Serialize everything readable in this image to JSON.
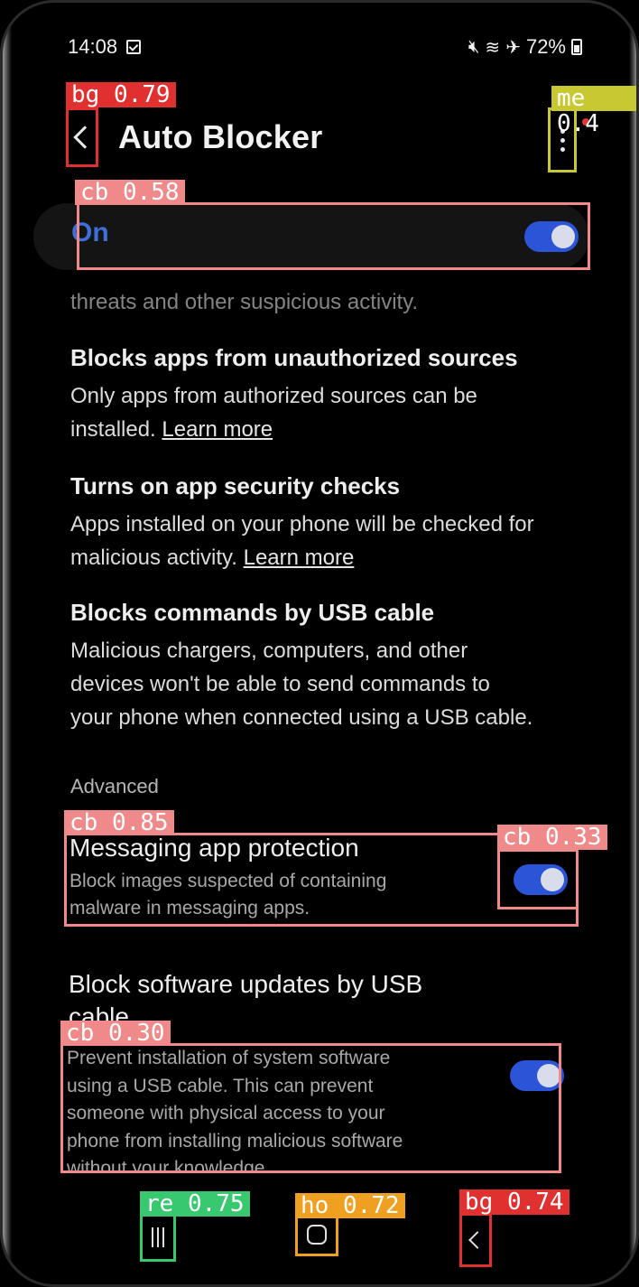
{
  "status_bar": {
    "time": "14:08",
    "battery": "72%"
  },
  "app_bar": {
    "title": "Auto Blocker"
  },
  "master_toggle": {
    "label": "On",
    "checked": true
  },
  "partial_text": "threats and other suspicious activity.",
  "features": [
    {
      "heading": "Blocks apps from unauthorized sources",
      "body_line1": "Only apps from authorized sources can be",
      "body_line2": "installed.",
      "link": "Learn more"
    },
    {
      "heading": "Turns on app security checks",
      "body_line1": "Apps installed on your phone will be checked for",
      "body_line2": "malicious activity.",
      "link": "Learn more"
    },
    {
      "heading": "Blocks commands by USB cable",
      "body_line1": "Malicious chargers, computers, and other",
      "body_line2": "devices won't be able to send commands to",
      "body_line3": "your phone when connected using a USB cable."
    }
  ],
  "advanced": {
    "section_label": "Advanced",
    "messaging": {
      "title": "Messaging app protection",
      "subtitle_line1": "Block images suspected of containing",
      "subtitle_line2": "malware in messaging apps.",
      "checked": true
    },
    "usb_updates": {
      "title_line1": "Block software updates by USB",
      "title_line2": "cable",
      "subtitle_line1": "Prevent installation of system software",
      "subtitle_line2": "using a USB cable. This can prevent",
      "subtitle_line3": "someone with physical access to your",
      "subtitle_line4": "phone from installing malicious software",
      "subtitle_line5": "without your knowledge.",
      "checked": true
    }
  },
  "detections": {
    "back_top": "bg 0.79",
    "menu": "me 0.4",
    "master_cb": "cb 0.58",
    "messaging_cb": "cb 0.85",
    "messaging_switch_cb": "cb 0.33",
    "usb_cb": "cb 0.30",
    "recents": "re 0.75",
    "home": "ho 0.72",
    "back_bottom": "bg 0.74"
  },
  "colors": {
    "accent": "#2b55d6",
    "background": "#000000",
    "detect_red": "#e03030",
    "detect_pink": "#f08a8a",
    "detect_yellow": "#c8c832",
    "detect_green": "#38c870",
    "detect_orange": "#f0a020"
  },
  "icons": [
    "back-icon",
    "more-options-icon",
    "recents-icon",
    "home-icon",
    "nav-back-icon",
    "mute-icon",
    "wifi-icon",
    "airplane-icon",
    "battery-icon"
  ]
}
